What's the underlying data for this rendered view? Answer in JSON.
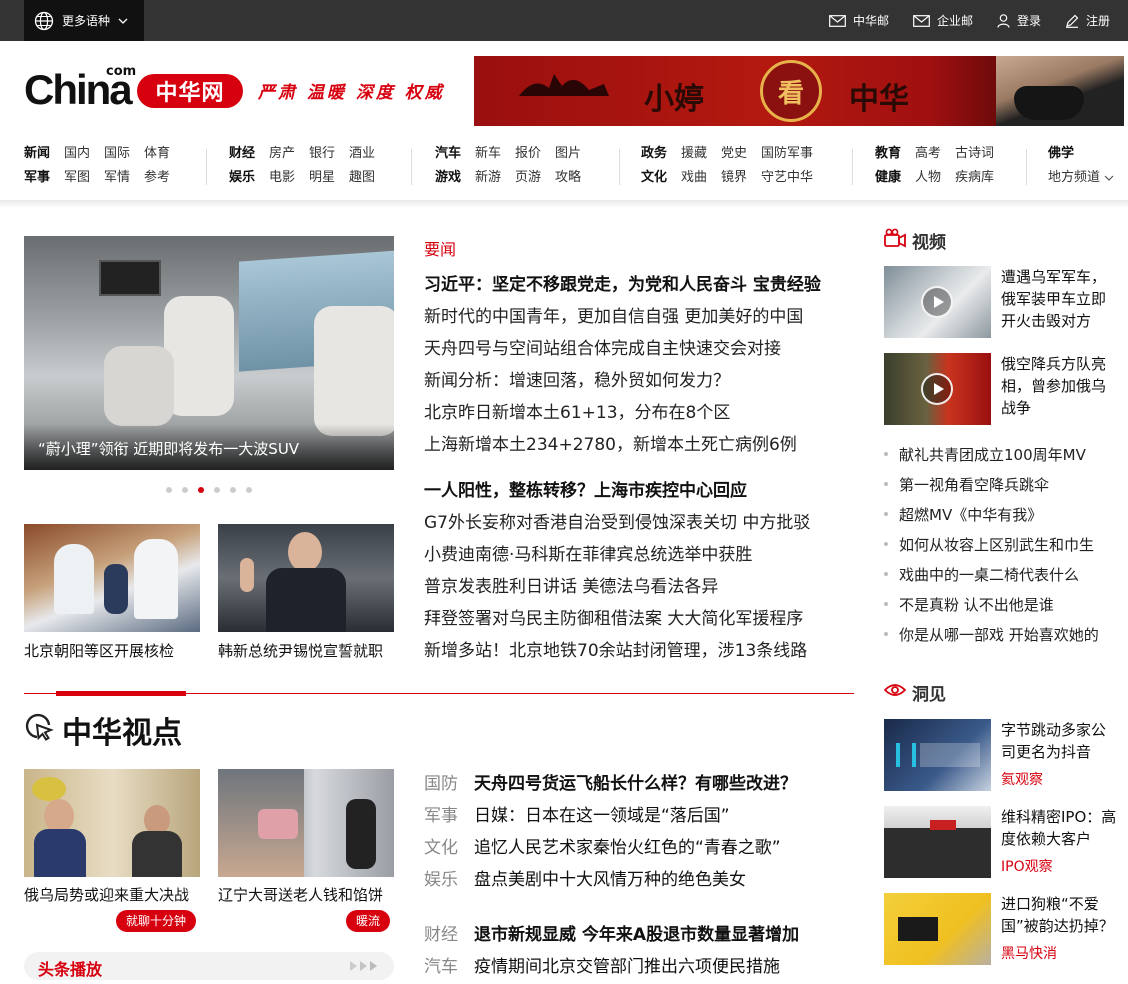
{
  "topbar": {
    "lang_label": "更多语种",
    "links": [
      {
        "icon": "mail-icon",
        "label": "中华邮"
      },
      {
        "icon": "mail-icon",
        "label": "企业邮"
      },
      {
        "icon": "user-icon",
        "label": "登录"
      },
      {
        "icon": "edit-icon",
        "label": "注册"
      }
    ]
  },
  "header": {
    "logo_en": "China",
    "logo_com": "com",
    "logo_cn": "中华网",
    "slogan": "严肃 温暖 深度 权威",
    "banner_text": [
      "小婷",
      "看",
      "中华"
    ]
  },
  "nav": [
    {
      "rows": [
        [
          "新闻",
          "国内",
          "国际",
          "体育"
        ],
        [
          "军事",
          "军图",
          "军情",
          "参考"
        ]
      ]
    },
    {
      "rows": [
        [
          "财经",
          "房产",
          "银行",
          "酒业"
        ],
        [
          "娱乐",
          "电影",
          "明星",
          "趣图"
        ]
      ]
    },
    {
      "rows": [
        [
          "汽车",
          "新车",
          "报价",
          "图片"
        ],
        [
          "游戏",
          "新游",
          "页游",
          "攻略"
        ]
      ]
    },
    {
      "rows": [
        [
          "政务",
          "援藏",
          "党史",
          "国防军事"
        ],
        [
          "文化",
          "戏曲",
          "镜界",
          "守艺中华"
        ]
      ]
    },
    {
      "rows": [
        [
          "教育",
          "高考",
          "古诗词"
        ],
        [
          "健康",
          "人物",
          "疾病库"
        ]
      ]
    },
    {
      "rows": [
        [
          "佛学"
        ],
        [
          "地方频道"
        ]
      ]
    }
  ],
  "carousel": {
    "caption": "“蔚小理”领衔 近期即将发布一大波SUV",
    "dot_count": 6,
    "active_dot": 2
  },
  "thumbs": [
    {
      "caption": "北京朝阳等区开展核检"
    },
    {
      "caption": "韩新总统尹锡悦宣誓就职"
    }
  ],
  "headlines": {
    "label": "要闻",
    "items": [
      {
        "text": "习近平：坚定不移跟党走，为党和人民奋斗 宝贵经验",
        "bold": true
      },
      {
        "text": "新时代的中国青年，更加自信自强 更加美好的中国",
        "bold": false
      },
      {
        "text": "天舟四号与空间站组合体完成自主快速交会对接",
        "bold": false
      },
      {
        "text": "新闻分析：增速回落，稳外贸如何发力？",
        "bold": false
      },
      {
        "text": "北京昨日新增本土61+13，分布在8个区",
        "bold": false
      },
      {
        "text": "上海新增本土234+2780，新增本土死亡病例6例",
        "bold": false
      },
      {
        "text": "一人阳性，整栋转移？上海市疾控中心回应",
        "bold": true
      },
      {
        "text": "G7外长妄称对香港自治受到侵蚀深表关切 中方批驳",
        "bold": false
      },
      {
        "text": "小费迪南德·马科斯在菲律宾总统选举中获胜",
        "bold": false
      },
      {
        "text": "普京发表胜利日讲话 美德法乌看法各异",
        "bold": false
      },
      {
        "text": "拜登签署对乌民主防御租借法案 大大简化军援程序",
        "bold": false
      },
      {
        "text": "新增多站！北京地铁70余站封闭管理，涉13条线路",
        "bold": false
      }
    ]
  },
  "zhonghua": {
    "title": "中华视点",
    "thumbs": [
      {
        "caption": "俄乌局势或迎来重大决战",
        "tag": "就聊十分钟"
      },
      {
        "caption": "辽宁大哥送老人钱和馅饼",
        "tag": "暖流"
      }
    ],
    "toutiao": "头条播放",
    "items": [
      {
        "cat": "国防",
        "text": "天舟四号货运飞船长什么样？有哪些改进？",
        "bold": true
      },
      {
        "cat": "军事",
        "text": "日媒：日本在这一领域是“落后国”",
        "bold": false
      },
      {
        "cat": "文化",
        "text": "追忆人民艺术家秦怡火红色的“青春之歌”",
        "bold": false
      },
      {
        "cat": "娱乐",
        "text": "盘点美剧中十大风情万种的绝色美女",
        "bold": false
      },
      {
        "cat": "财经",
        "text": "退市新规显威 今年来A股退市数量显著增加",
        "bold": true
      },
      {
        "cat": "汽车",
        "text": "疫情期间北京交管部门推出六项便民措施",
        "bold": false
      }
    ]
  },
  "video": {
    "title": "视频",
    "items": [
      {
        "text": "遭遇乌军军车，俄军装甲车立即开火击毁对方"
      },
      {
        "text": "俄空降兵方队亮相，曾参加俄乌战争"
      }
    ],
    "list": [
      "献礼共青团成立100周年MV",
      "第一视角看空降兵跳伞",
      "超燃MV《中华有我》",
      "如何从妆容上区别武生和巾生",
      "戏曲中的一桌二椅代表什么",
      "不是真粉 认不出他是谁",
      "你是从哪一部戏 开始喜欢她的"
    ]
  },
  "insight": {
    "title": "洞见",
    "items": [
      {
        "text": "字节跳动多家公司更名为抖音",
        "src": "氦观察"
      },
      {
        "text": "维科精密IPO：高度依赖大客户",
        "src": "IPO观察"
      },
      {
        "text": "进口狗粮“不爱国”被韵达扔掉？",
        "src": "黑马快消"
      }
    ]
  }
}
